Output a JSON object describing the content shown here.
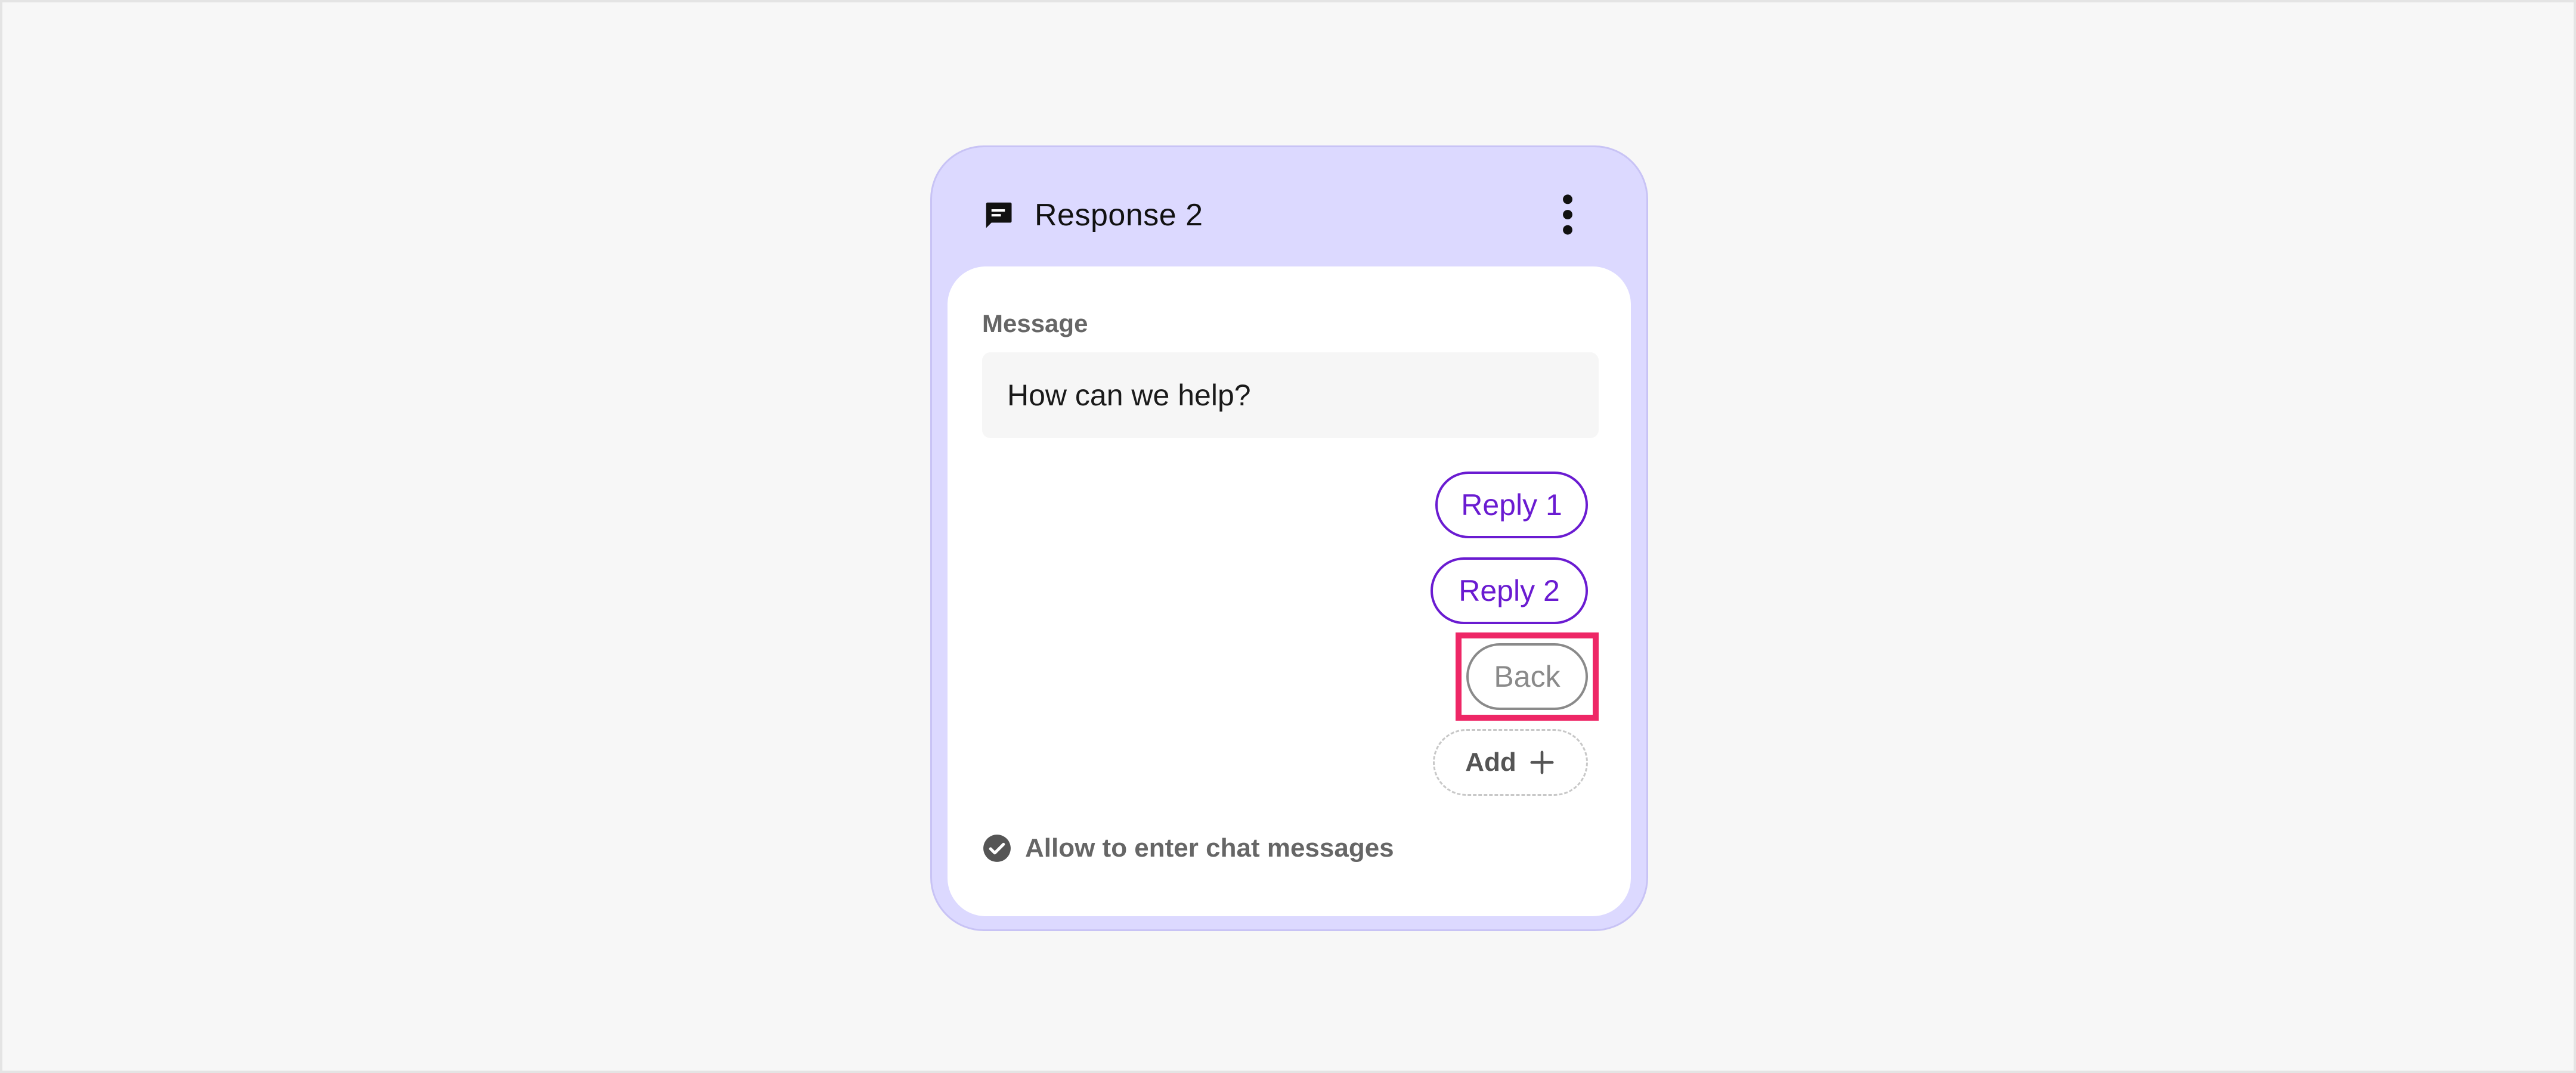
{
  "card": {
    "title": "Response 2",
    "header_icon": "chat-bubble-icon",
    "menu_icon": "more-vertical-icon"
  },
  "message": {
    "label": "Message",
    "value": "How can we help?"
  },
  "replies": [
    {
      "label": "Reply 1"
    },
    {
      "label": "Reply 2"
    }
  ],
  "back": {
    "label": "Back"
  },
  "add": {
    "label": "Add",
    "icon": "plus-icon"
  },
  "allow": {
    "label": "Allow to enter chat messages",
    "icon": "check-circle-icon"
  },
  "colors": {
    "card_background": "#dcd9ff",
    "accent": "#6a1bd1",
    "highlight": "#ee2766",
    "muted": "#8a8a8a"
  }
}
